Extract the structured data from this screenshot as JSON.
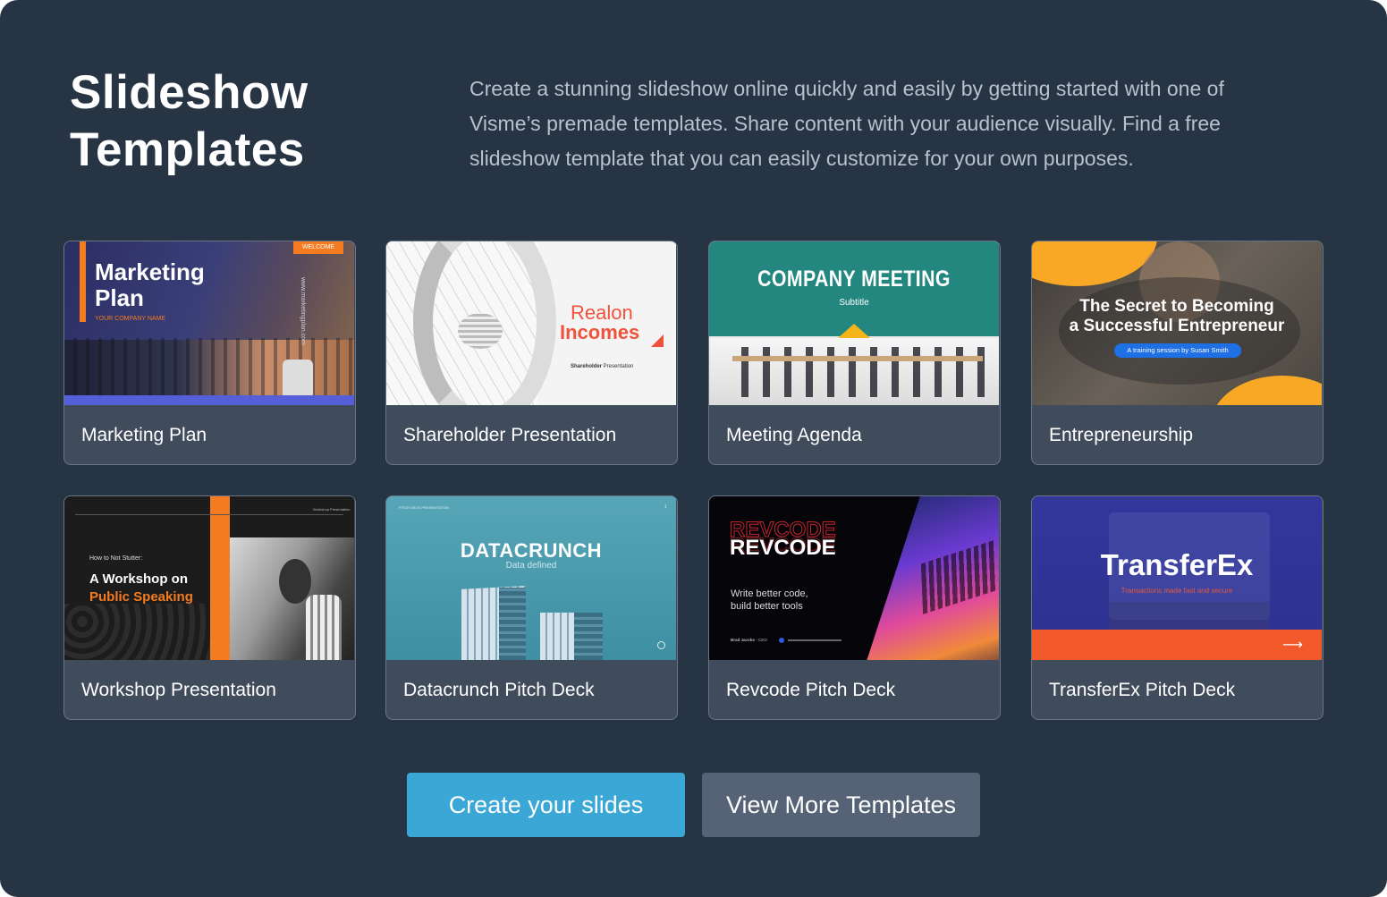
{
  "header": {
    "title": "Slideshow Templates",
    "description": "Create a stunning slideshow online quickly and easily by getting started with one of Visme’s premade templates. Share content with your audience visually. Find a free slideshow template that you can easily customize for your own purposes."
  },
  "templates": [
    {
      "label": "Marketing Plan",
      "thumb": {
        "badge": "WELCOME",
        "title_line1": "Marketing",
        "title_line2": "Plan",
        "subtitle": "YOUR COMPANY NAME",
        "side_text": "www.marketingplan.com"
      }
    },
    {
      "label": "Shareholder Presentation",
      "thumb": {
        "title_line1": "Realon",
        "title_line2": "Incomes",
        "footer_bold": "Shareholder",
        "footer_rest": " Presentation"
      }
    },
    {
      "label": "Meeting Agenda",
      "thumb": {
        "title": "COMPANY MEETING",
        "subtitle": "Subtitle"
      }
    },
    {
      "label": "Entrepreneurship",
      "thumb": {
        "title_line1": "The Secret to Becoming",
        "title_line2": "a Successful Entrepreneur",
        "pill": "A training session by Susan Smith"
      }
    },
    {
      "label": "Workshop Presentation",
      "thumb": {
        "corner": "Workshop Presentation",
        "kicker": "How to Not Stutter:",
        "title_line1": "A Workshop on",
        "title_line2": "Public Speaking"
      }
    },
    {
      "label": "Datacrunch Pitch Deck",
      "thumb": {
        "corner": "PITCH DECK PRESENTATION",
        "page": "1",
        "title": "DATACRUNCH",
        "subtitle": "Data defined"
      }
    },
    {
      "label": "Revcode Pitch Deck",
      "thumb": {
        "title": "REVCODE",
        "tagline_line1": "Write better code,",
        "tagline_line2": "build better tools",
        "author": "Brad Jacobs",
        "role": " - CEO"
      }
    },
    {
      "label": "TransferEx Pitch Deck",
      "thumb": {
        "title": "TransferEx",
        "subtitle": "Transactions made fast and secure"
      }
    }
  ],
  "actions": {
    "primary_label": "Create your slides",
    "secondary_label": "View More Templates"
  },
  "colors": {
    "panel_bg": "#263443",
    "card_bg": "#404b5c",
    "primary_button": "#3ba7d6",
    "secondary_button": "#566275",
    "accent_orange": "#f47b20"
  }
}
